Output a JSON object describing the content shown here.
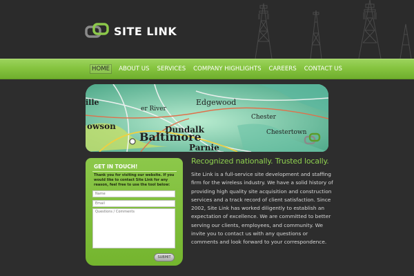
{
  "brand": {
    "name": "SITE LINK",
    "accent_color": "#8cc84a",
    "logo_icon": "chain-link-logo-icon"
  },
  "nav": {
    "items": [
      {
        "label": "HOME",
        "active": true
      },
      {
        "label": "ABOUT US",
        "active": false
      },
      {
        "label": "SERVICES",
        "active": false
      },
      {
        "label": "COMPANY HIGHLIGHTS",
        "active": false
      },
      {
        "label": "CAREERS",
        "active": false
      },
      {
        "label": "CONTACT US",
        "active": false
      }
    ]
  },
  "banner": {
    "map_labels": [
      "Baltimore",
      "Dundalk",
      "Edgewood",
      "owson",
      "Parnie",
      "ille",
      "er River",
      "Chester",
      "Chestertown"
    ]
  },
  "contact": {
    "title": "GET IN TOUCH!",
    "intro": "Thank you for visiting our website. If you would like to contact Site Link for any reason, feel free to use the tool below:",
    "name_placeholder": "Name",
    "email_placeholder": "Email",
    "comments_placeholder": "Questions / Comments",
    "submit_label": "SUBMIT"
  },
  "main": {
    "tagline": "Recognized nationally. Trusted locally.",
    "body": "Site Link is a full-service site development and staffing firm for the wireless industry. We have a solid history of providing high quality site acquisition and construction services and a track record of client satisfaction. Since 2002, Site Link has worked diligently to establish an expectation of excellence. We are committed to better serving our clients, employees, and community. We invite you to contact us with any questions or comments and look forward to your correspondence."
  }
}
